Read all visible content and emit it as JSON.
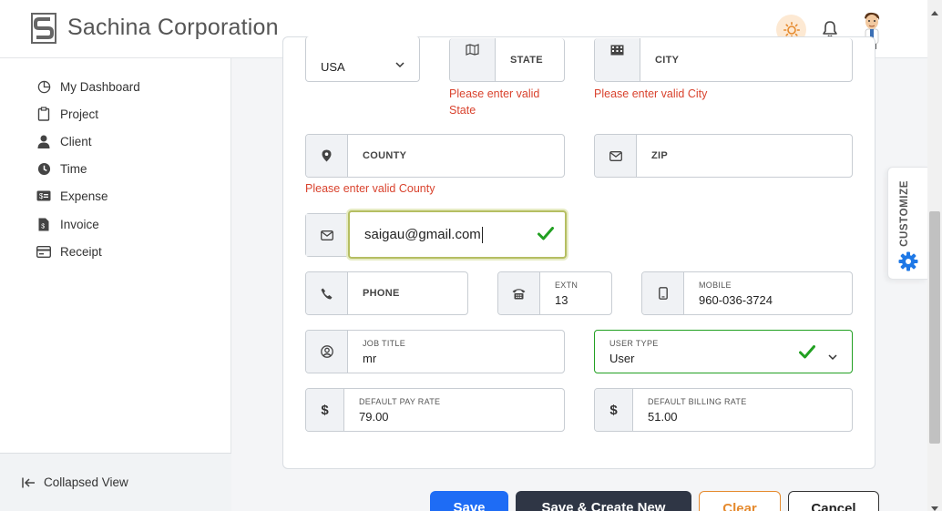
{
  "header": {
    "brand": "Sachina Corporation"
  },
  "sidebar": {
    "items": [
      {
        "label": "My Dashboard",
        "icon": "dashboard-icon"
      },
      {
        "label": "Project",
        "icon": "clipboard-icon"
      },
      {
        "label": "Client",
        "icon": "user-icon"
      },
      {
        "label": "Time",
        "icon": "clock-icon"
      },
      {
        "label": "Expense",
        "icon": "money-icon"
      },
      {
        "label": "Invoice",
        "icon": "invoice-icon"
      },
      {
        "label": "Receipt",
        "icon": "receipt-icon"
      }
    ],
    "collapse_label": "Collapsed View"
  },
  "form": {
    "country_value": "USA",
    "state_placeholder": "STATE",
    "state_error": "Please enter valid State",
    "city_placeholder": "CITY",
    "city_error": "Please enter valid City",
    "county_placeholder": "COUNTY",
    "county_error": "Please enter valid County",
    "zip_placeholder": "ZIP",
    "email_value": "saigau@gmail.com",
    "phone_placeholder": "PHONE",
    "extn_label": "EXTN",
    "extn_value": "13",
    "mobile_label": "MOBILE",
    "mobile_value": "960-036-3724",
    "job_title_label": "JOB TITLE",
    "job_title_value": "mr",
    "user_type_label": "USER TYPE",
    "user_type_value": "User",
    "pay_rate_label": "DEFAULT PAY RATE",
    "pay_rate_value": "79.00",
    "billing_rate_label": "DEFAULT BILLING RATE",
    "billing_rate_value": "51.00",
    "currency_symbol": "$"
  },
  "buttons": {
    "save": "Save",
    "save_create_new": "Save & Create New",
    "clear": "Clear",
    "cancel": "Cancel"
  },
  "customize_label": "CUSTOMIZE",
  "colors": {
    "error": "#d9432e",
    "success": "#22a022",
    "primary": "#1e6cf5",
    "dark": "#2f3645",
    "accent_orange": "#e58a2e",
    "customize_icon": "#1e78e6"
  }
}
